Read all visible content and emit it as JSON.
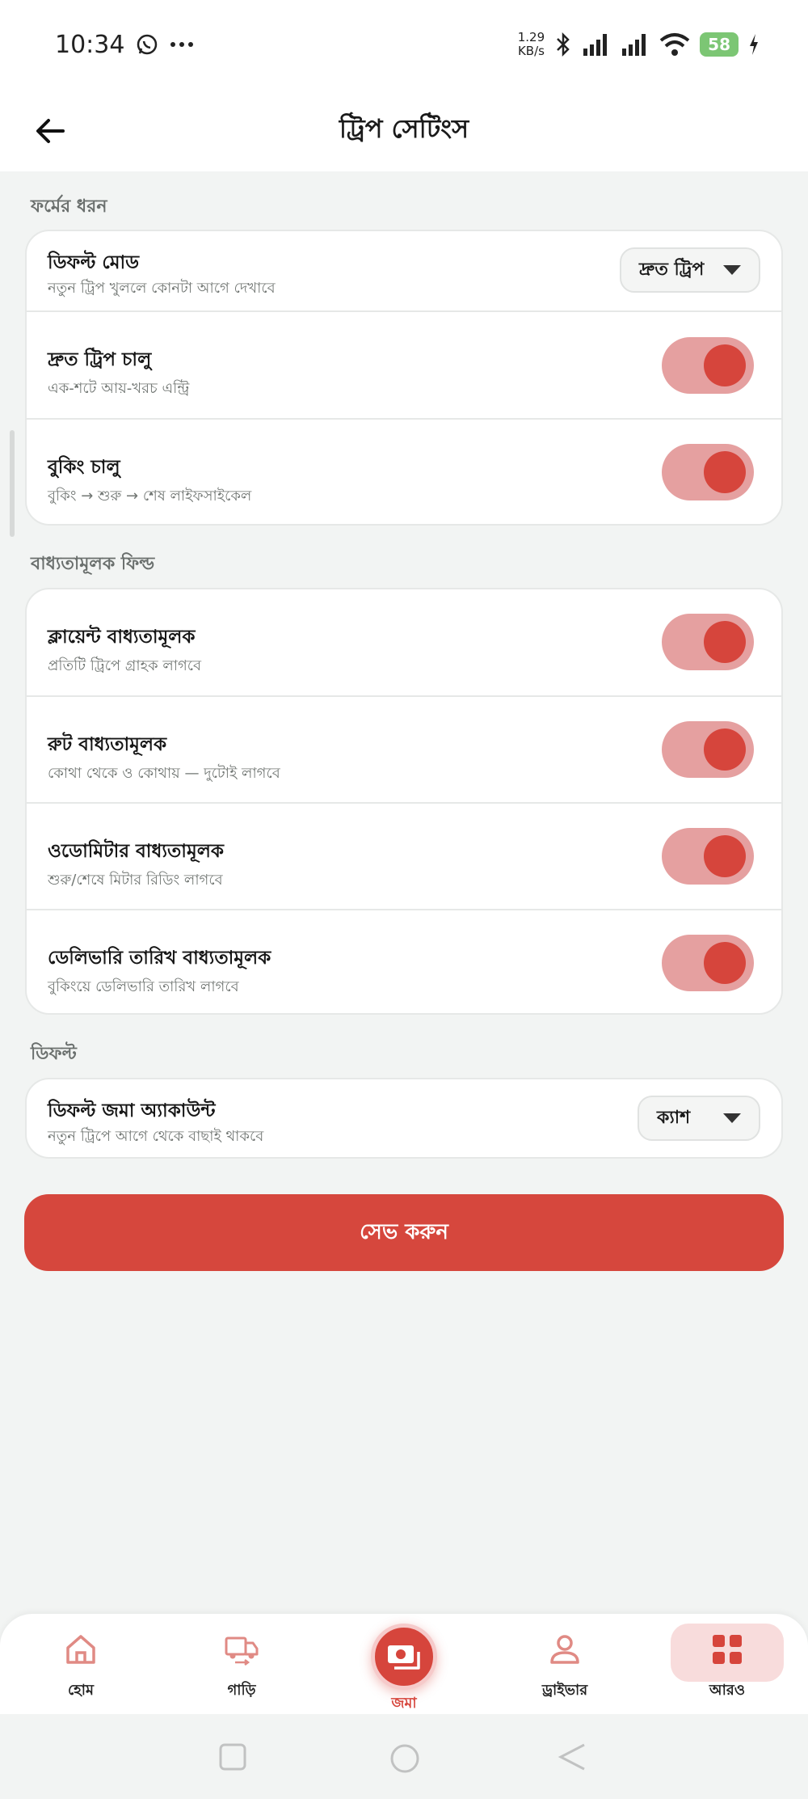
{
  "status_bar": {
    "time": "10:34",
    "net_speed_value": "1.29",
    "net_speed_unit": "KB/s",
    "battery": "58",
    "icons": [
      "whatsapp-icon",
      "more-dots-icon",
      "bluetooth-icon",
      "signal-icon",
      "signal-icon",
      "wifi-icon",
      "battery-icon",
      "charging-icon"
    ]
  },
  "app_bar": {
    "title": "ট্রিপ সেটিংস",
    "back_icon": "arrow-left-icon"
  },
  "sections": {
    "form_type": {
      "label": "ফর্মের ধরন",
      "default_mode": {
        "title": "ডিফল্ট মোড",
        "subtitle": "নতুন ট্রিপ খুললে কোনটা আগে দেখাবে",
        "value": "দ্রুত ট্রিপ"
      },
      "quick_trip": {
        "title": "দ্রুত ট্রিপ চালু",
        "subtitle": "এক-শটে আয়-খরচ এন্ট্রি",
        "enabled": true
      },
      "booking": {
        "title": "বুকিং চালু",
        "subtitle": "বুকিং → শুরু → শেষ লাইফসাইকেল",
        "enabled": true
      }
    },
    "mandatory": {
      "label": "বাধ্যতামূলক ফিল্ড",
      "client": {
        "title": "ক্লায়েন্ট বাধ্যতামূলক",
        "subtitle": "প্রতিটি ট্রিপে গ্রাহক লাগবে",
        "enabled": true
      },
      "route": {
        "title": "রুট বাধ্যতামূলক",
        "subtitle": "কোথা থেকে ও কোথায় — দুটোই লাগবে",
        "enabled": true
      },
      "odometer": {
        "title": "ওডোমিটার বাধ্যতামূলক",
        "subtitle": "শুরু/শেষে মিটার রিডিং লাগবে",
        "enabled": true
      },
      "delivery_date": {
        "title": "ডেলিভারি তারিখ বাধ্যতামূলক",
        "subtitle": "বুকিংয়ে ডেলিভারি তারিখ লাগবে",
        "enabled": true
      }
    },
    "defaults": {
      "label": "ডিফল্ট",
      "deposit_account": {
        "title": "ডিফল্ট জমা অ্যাকাউন্ট",
        "subtitle": "নতুন ট্রিপে আগে থেকে বাছাই থাকবে",
        "value": "ক্যাশ"
      }
    }
  },
  "save_button": "সেভ করুন",
  "bottom_nav": {
    "home": "হোম",
    "vehicles": "গাড়ি",
    "deposit": "জমা",
    "driver": "ড্রাইভার",
    "more": "আরও"
  },
  "colors": {
    "accent": "#d6453c",
    "toggle_track": "#e5a0a0",
    "background": "#f2f4f3",
    "card": "#ffffff"
  }
}
